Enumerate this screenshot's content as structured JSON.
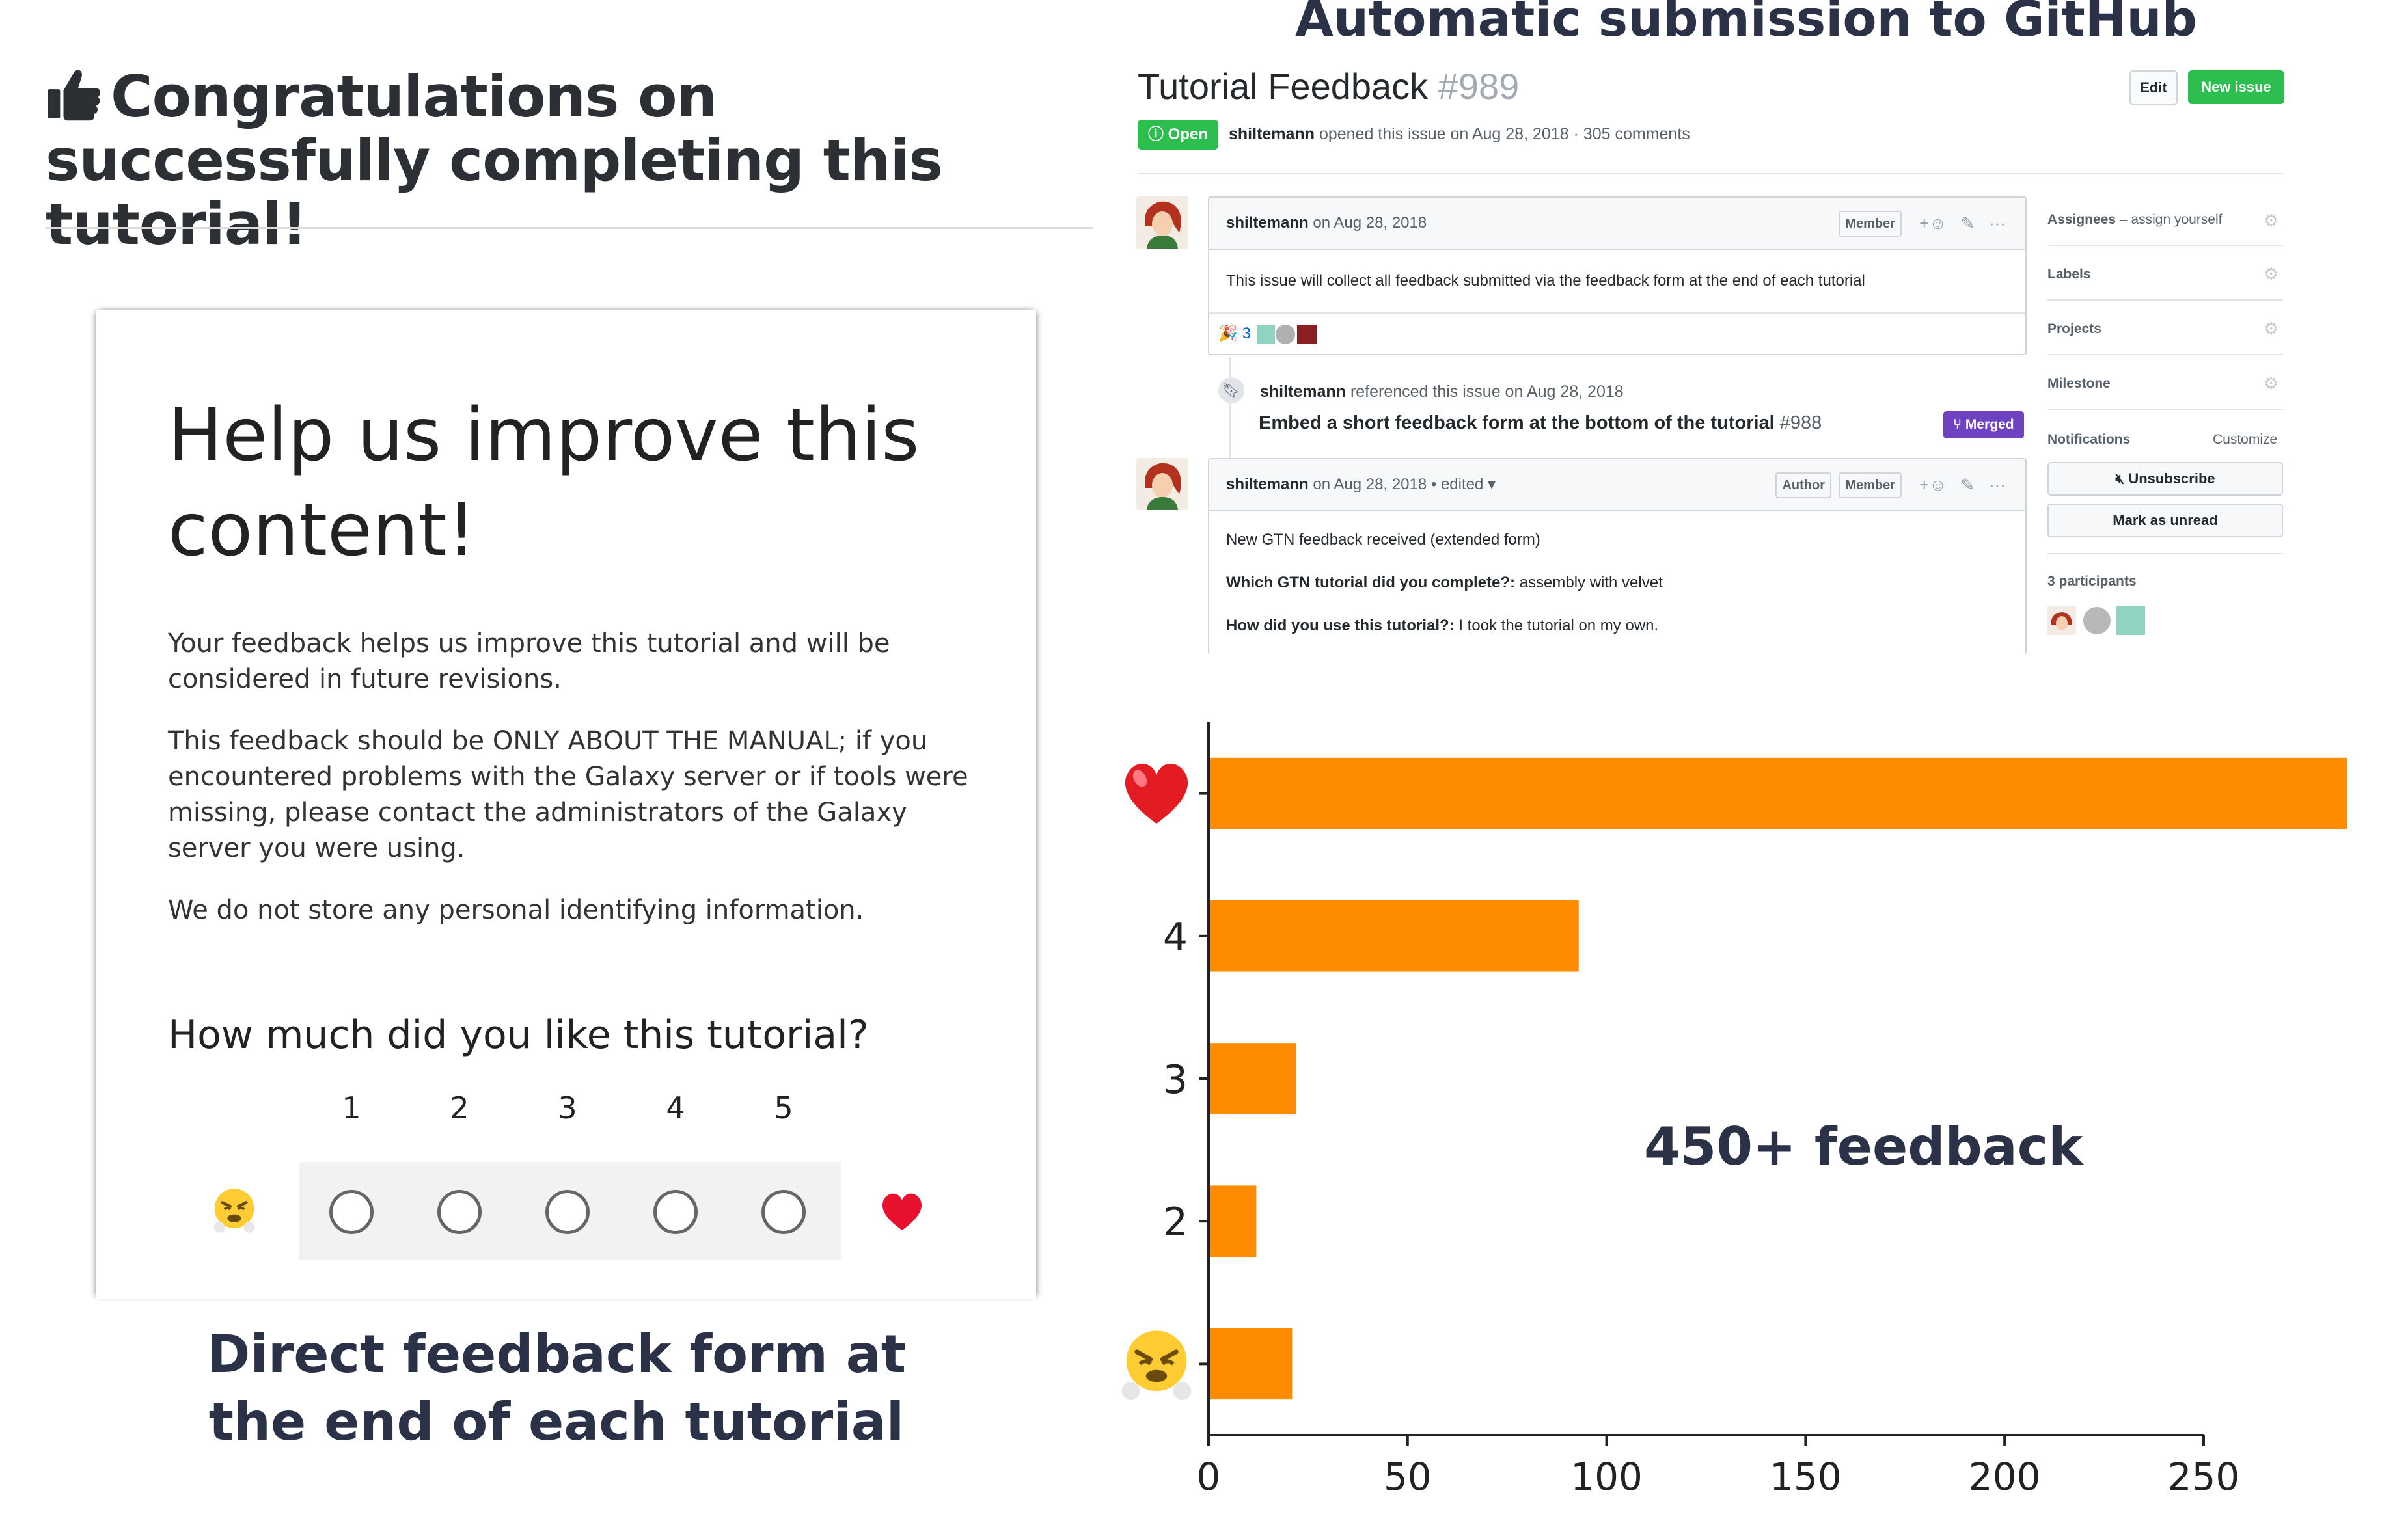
{
  "left_panel": {
    "congrats_text": "Congratulations on successfully completing this tutorial!",
    "form": {
      "title": "Help us improve this content!",
      "paragraph_1": "Your feedback helps us improve this tutorial and will be considered in future revisions.",
      "paragraph_2": "This feedback should be ONLY ABOUT THE MANUAL; if you encountered problems with the Galaxy server or if tools were missing, please contact the administrators of the Galaxy server you were using.",
      "paragraph_3": "We do not store any personal identifying information.",
      "question": "How much did you like this tutorial?",
      "scale": [
        "1",
        "2",
        "3",
        "4",
        "5"
      ],
      "scale_low_icon": "angry-face-icon",
      "scale_high_icon": "red-heart-icon"
    },
    "caption": "Direct feedback form at the end of each tutorial"
  },
  "github": {
    "heading": "Automatic submission to GitHub",
    "issue_title": "Tutorial Feedback",
    "issue_number": "#989",
    "edit_label": "Edit",
    "new_issue_label": "New issue",
    "state": "Open",
    "author": "shiltemann",
    "meta": "opened this issue on Aug 28, 2018 · 305 comments",
    "comment_1": {
      "author": "shiltemann",
      "date": "on Aug 28, 2018",
      "role": "Member",
      "body": "This issue will collect all feedback submitted via the feedback form at the end of each tutorial",
      "reaction_count": "3"
    },
    "reference": {
      "author": "shiltemann",
      "text": "referenced this issue on Aug 28, 2018",
      "title": "Embed a short feedback form at the bottom of the tutorial",
      "pr_number": "#988",
      "badge": "Merged"
    },
    "comment_2": {
      "author": "shiltemann",
      "date": "on Aug 28, 2018 • edited ▾",
      "role_1": "Author",
      "role_2": "Member",
      "line_1": "New GTN feedback received (extended form)",
      "q1_label": "Which GTN tutorial did you complete?:",
      "q1_answer": "assembly with velvet",
      "q2_label": "How did you use this tutorial?:",
      "q2_answer": "I took the tutorial on my own."
    },
    "sidebar": {
      "assignees": "Assignees",
      "assignees_hint": "– assign yourself",
      "labels": "Labels",
      "projects": "Projects",
      "milestone": "Milestone",
      "notifications": "Notifications",
      "customize": "Customize",
      "unsubscribe": "Unsubscribe",
      "mark_unread": "Mark as unread",
      "participants": "3 participants"
    }
  },
  "chart_data": {
    "type": "bar",
    "orientation": "horizontal",
    "categories": [
      "1",
      "2",
      "3",
      "4",
      "5"
    ],
    "category_labels": [
      "",
      "2",
      "3",
      "4",
      ""
    ],
    "category_icons": {
      "1": "angry-face-icon",
      "5": "red-heart-icon"
    },
    "values": [
      21,
      12,
      22,
      93,
      286
    ],
    "xlim": [
      0,
      285
    ],
    "xticks": [
      "0",
      "50",
      "100",
      "150",
      "200",
      "250"
    ],
    "bar_color": "#ff8c00",
    "annotation": "450+ feedback",
    "grid": false
  }
}
